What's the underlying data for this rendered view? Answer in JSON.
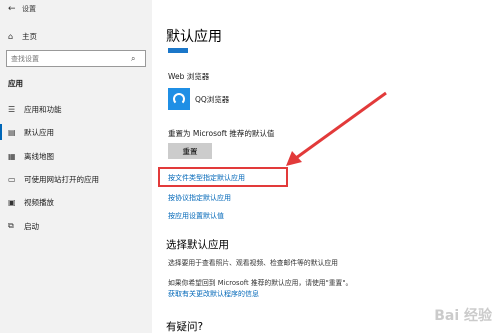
{
  "window": {
    "title": "设置"
  },
  "sidebar": {
    "home": "主页",
    "search_placeholder": "查找设置",
    "section": "应用",
    "items": [
      {
        "label": "应用和功能",
        "icon": "list-icon"
      },
      {
        "label": "默认应用",
        "icon": "default-apps-icon",
        "active": true
      },
      {
        "label": "离线地图",
        "icon": "map-icon"
      },
      {
        "label": "可使用网站打开的应用",
        "icon": "web-app-icon"
      },
      {
        "label": "视频播放",
        "icon": "video-icon"
      },
      {
        "label": "启动",
        "icon": "startup-icon"
      }
    ]
  },
  "main": {
    "title": "默认应用",
    "web_label": "Web 浏览器",
    "browser_name": "QQ浏览器",
    "reset_label": "重置为 Microsoft 推荐的默认值",
    "reset_button": "重置",
    "links": [
      "按文件类型指定默认应用",
      "按协议指定默认应用",
      "按应用设置默认值"
    ],
    "choose_title": "选择默认应用",
    "choose_desc": "选择要用于查看照片、观看视频、检查邮件等的默认应用",
    "recommend_text": "如果你希望回到 Microsoft 推荐的默认应用，请使用\"重置\"。",
    "more_link": "获取有关更改默认程序的信息",
    "faq_title": "有疑问?"
  },
  "colors": {
    "accent": "#0067b8",
    "highlight": "#e23a3a",
    "sidebar_bg": "#f2f2f2"
  },
  "watermark": "Baidu 经验"
}
